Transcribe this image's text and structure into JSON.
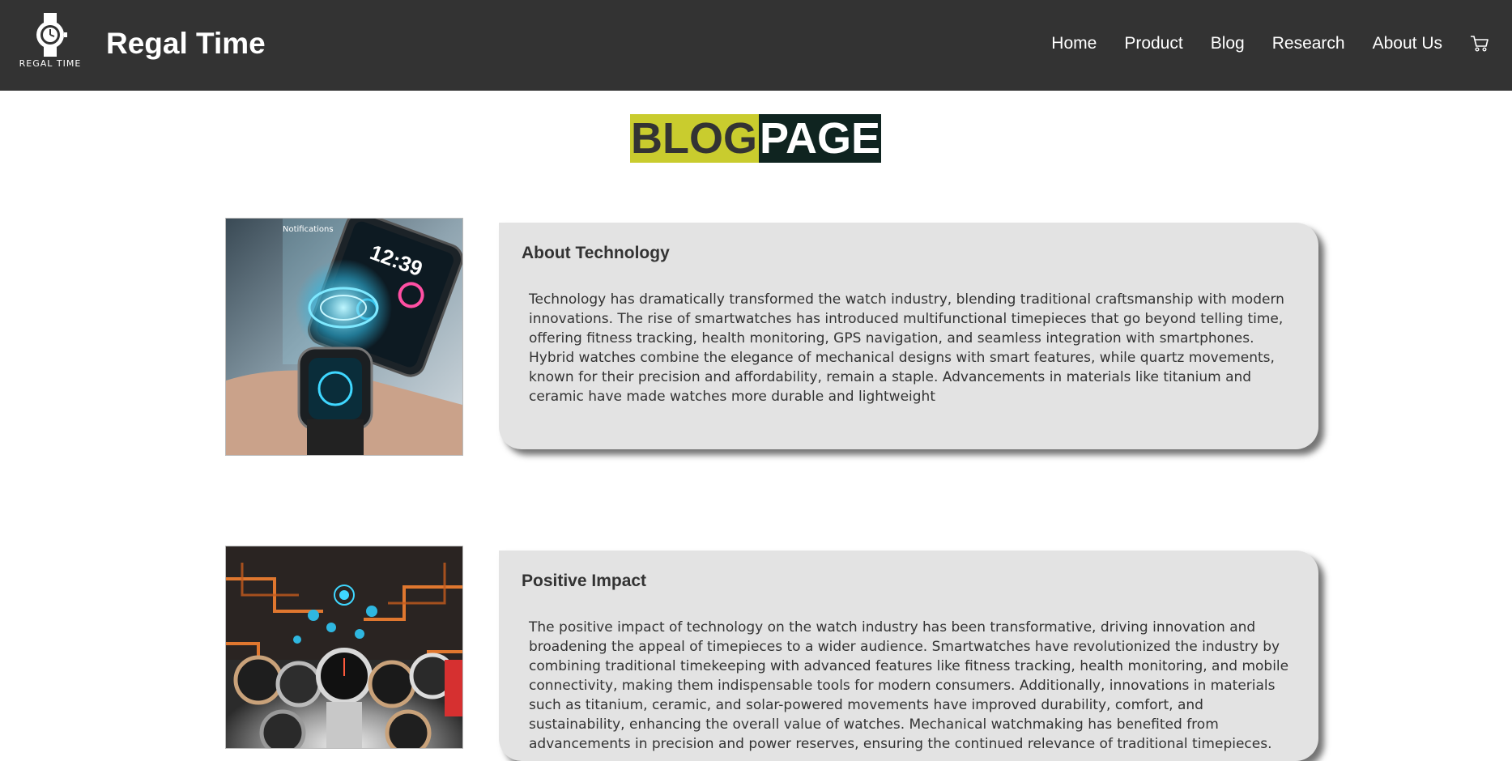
{
  "navbar": {
    "logo_text": "REGAL TIME",
    "brand": "Regal Time",
    "links": [
      "Home",
      "Product",
      "Blog",
      "Research",
      "About Us"
    ],
    "cart_icon": "cart-icon"
  },
  "page_title": {
    "part1": "BLOG",
    "part2": "PAGE"
  },
  "posts": [
    {
      "title": "About Technology",
      "body": "Technology has dramatically transformed the watch industry, blending traditional craftsmanship with modern innovations. The rise of smartwatches has introduced multifunctional timepieces that go beyond telling time, offering fitness tracking, health monitoring, GPS navigation, and seamless integration with smartphones. Hybrid watches combine the elegance of mechanical designs with smart features, while quartz movements, known for their precision and affordability, remain a staple. Advancements in materials like titanium and ceramic have made watches more durable and lightweight",
      "image_time": "12:39",
      "image_label": "Notifications"
    },
    {
      "title": "Positive Impact",
      "body": "The positive impact of technology on the watch industry has been transformative, driving innovation and broadening the appeal of timepieces to a wider audience. Smartwatches have revolutionized the industry by combining traditional timekeeping with advanced features like fitness tracking, health monitoring, and mobile connectivity, making them indispensable tools for modern consumers. Additionally, innovations in materials such as titanium, ceramic, and solar-powered movements have improved durability, comfort, and sustainability, enhancing the overall value of watches. Mechanical watchmaking has benefited from advancements in precision and power reserves, ensuring the continued relevance of traditional timepieces."
    }
  ],
  "colors": {
    "navbar": "#333333",
    "accent_yellow": "#c9cc2e",
    "accent_dark": "#0f2420",
    "card": "#e3e3e3"
  }
}
